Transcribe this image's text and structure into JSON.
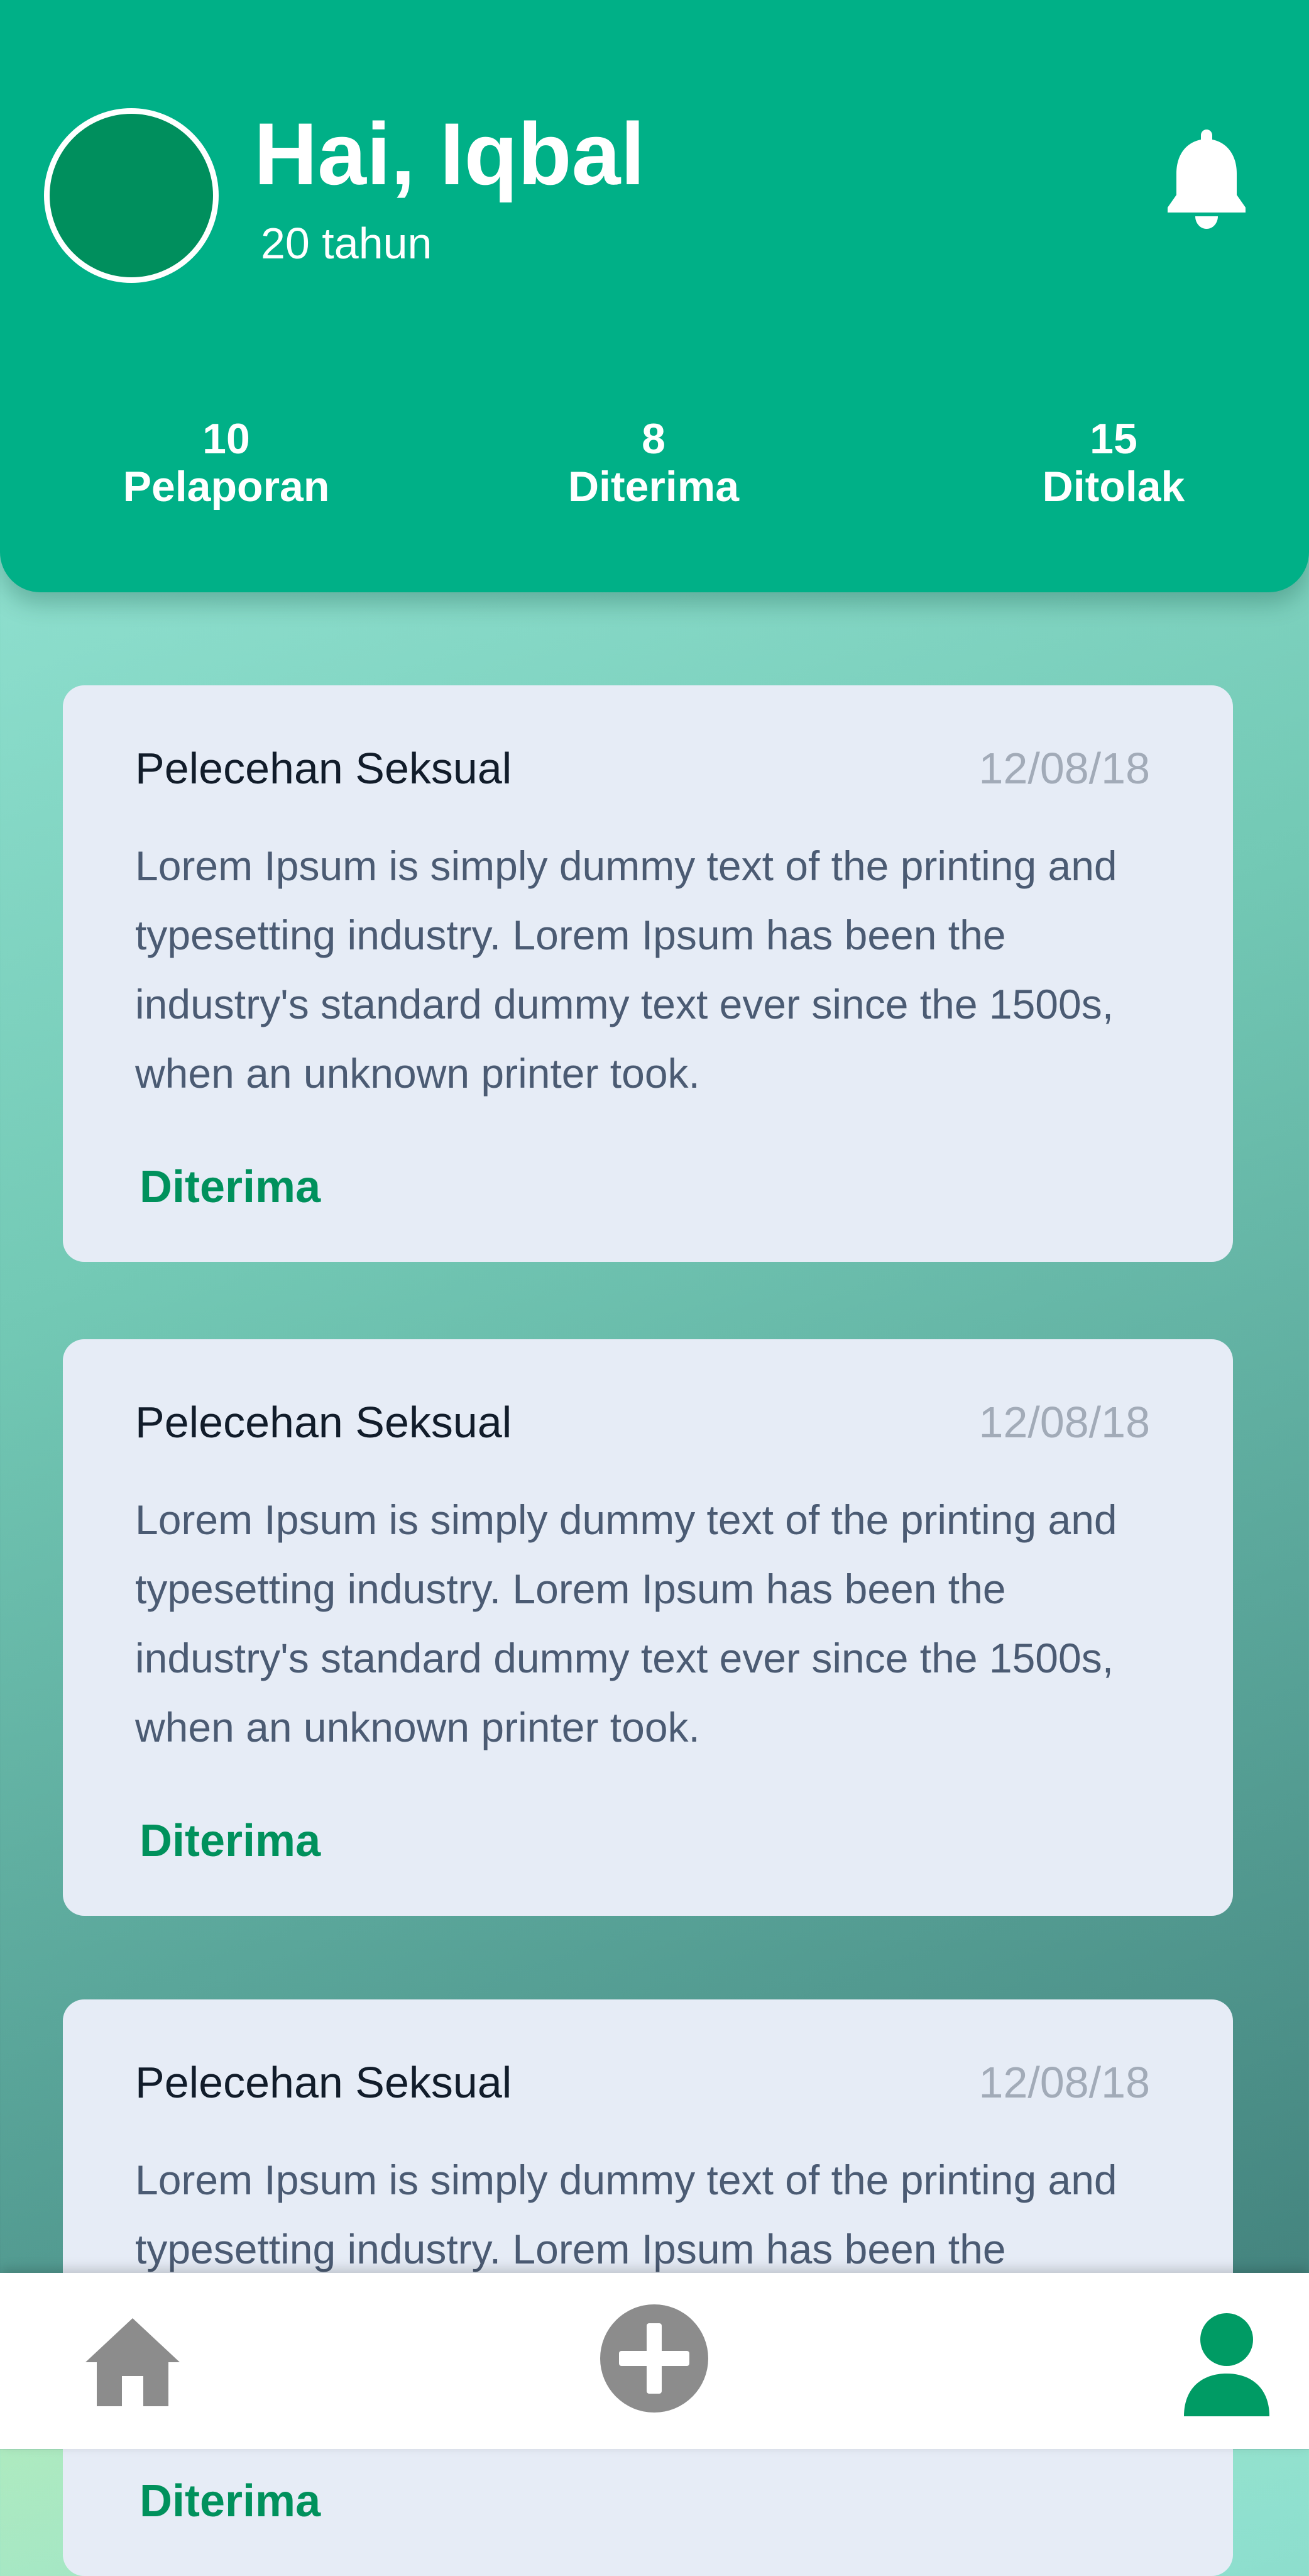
{
  "profile": {
    "greeting": "Hai, Iqbal",
    "age": "20 tahun"
  },
  "header": {
    "notification_icon": "bell-icon"
  },
  "stats": [
    {
      "value": "10",
      "label": "Pelaporan"
    },
    {
      "value": "8",
      "label": "Diterima"
    },
    {
      "value": "15",
      "label": "Ditolak"
    }
  ],
  "reports": [
    {
      "title": "Pelecehan Seksual",
      "date": "12/08/18",
      "body": "Lorem Ipsum is simply dummy text of the printing and typesetting industry. Lorem Ipsum has been the industry's standard dummy text ever since the 1500s, when an unknown printer took.",
      "status": "Diterima"
    },
    {
      "title": "Pelecehan Seksual",
      "date": "12/08/18",
      "body": "Lorem Ipsum is simply dummy text of the printing and typesetting industry. Lorem Ipsum has been the industry's standard dummy text ever since the 1500s, when an unknown printer took.",
      "status": "Diterima"
    },
    {
      "title": "Pelecehan Seksual",
      "date": "12/08/18",
      "body": "Lorem Ipsum is simply dummy text of the printing and typesetting industry. Lorem Ipsum has been the industry's standard dummy text ever since the 1500s, when an unknown printer took.",
      "status": "Diterima"
    }
  ],
  "nav": {
    "home_icon": "home-icon",
    "add_icon": "plus-circle-icon",
    "profile_icon": "user-icon"
  },
  "colors": {
    "primary": "#00b087",
    "accent_dark": "#008f5d",
    "status_accepted": "#00915c",
    "card_background": "#e6ecf6",
    "nav_inactive": "#8c8c8c"
  }
}
